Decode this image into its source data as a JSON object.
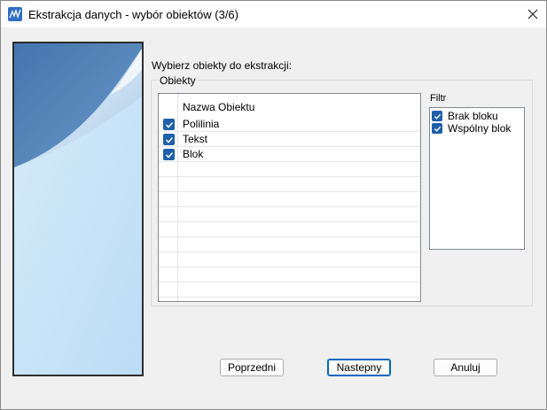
{
  "window": {
    "title": "Ekstrakcja danych - wybór obiektów (3/6)"
  },
  "main": {
    "prompt": "Wybierz obiekty do ekstrakcji:",
    "group_title": "Obiekty",
    "list": {
      "header": "Nazwa Obiektu",
      "items": [
        {
          "label": "Polilinia",
          "checked": true
        },
        {
          "label": "Tekst",
          "checked": true
        },
        {
          "label": "Blok",
          "checked": true
        }
      ]
    },
    "filter": {
      "label": "Filtr",
      "items": [
        {
          "label": "Brak bloku",
          "checked": true
        },
        {
          "label": "Wspólny blok",
          "checked": true
        }
      ]
    }
  },
  "buttons": {
    "prev": "Poprzedni",
    "next": "Nastepny",
    "cancel": "Anuluj"
  },
  "colors": {
    "accent": "#1f5fab",
    "panel_dark": "#4a7cb3",
    "panel_light": "#c6e2f7"
  }
}
